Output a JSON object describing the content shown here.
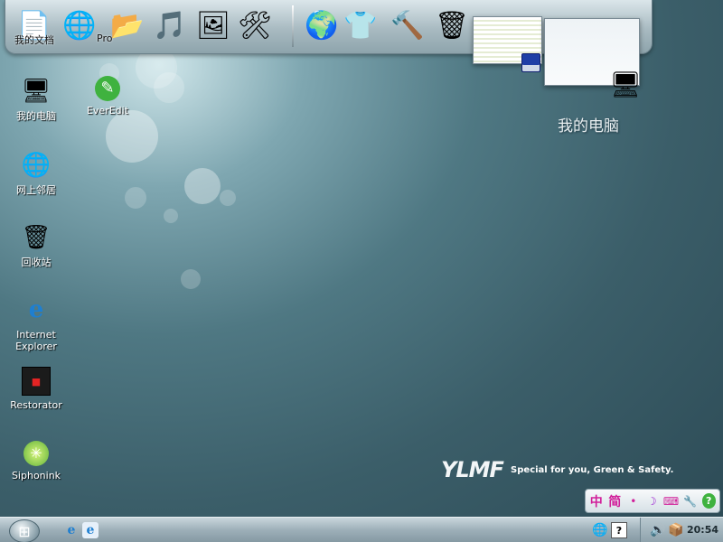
{
  "dock": {
    "items": [
      {
        "label": "我的文档",
        "icon": "documents-icon"
      },
      {
        "label": "Pro",
        "icon": "program-files-icon"
      },
      {
        "label": "",
        "icon": "folder-icon"
      },
      {
        "label": "",
        "icon": "music-folder-icon"
      },
      {
        "label": "",
        "icon": "picture-folder-icon"
      },
      {
        "label": "",
        "icon": "tools-icon"
      },
      {
        "label": "",
        "icon": "globe-icon"
      },
      {
        "label": "",
        "icon": "tshirt-icon"
      },
      {
        "label": "",
        "icon": "hammer-icon"
      },
      {
        "label": "",
        "icon": "recycle-bin-icon"
      }
    ]
  },
  "desktop": {
    "icons": [
      {
        "label": "我的电脑",
        "icon": "my-computer-icon"
      },
      {
        "label": "EverEdit",
        "icon": "everedit-icon"
      },
      {
        "label": "网上邻居",
        "icon": "network-icon"
      },
      {
        "label": "回收站",
        "icon": "recycle-bin-icon"
      },
      {
        "label": "Internet Explorer",
        "icon": "internet-explorer-icon"
      },
      {
        "label": "Restorator",
        "icon": "restorator-icon"
      },
      {
        "label": "Siphonink",
        "icon": "siphonink-icon"
      }
    ],
    "big_label": "我的电脑"
  },
  "branding": {
    "logo": "YLMF",
    "tagline": "Special for you, Green & Safety."
  },
  "ime": {
    "items": [
      "中",
      "简",
      "full-width-icon",
      "moon-icon",
      "keyboard-icon",
      "wrench-icon",
      "help-icon"
    ]
  },
  "taskbar": {
    "start": "windows-logo-icon",
    "quick_launch": [
      "internet-explorer-icon",
      "ie-shortcut-icon"
    ],
    "tray": [
      "network-tray-icon",
      "help-tray-icon",
      "volume-icon",
      "box-icon"
    ],
    "clock": "20:54"
  },
  "colors": {
    "desktop_bg": "#4f7883",
    "accent": "#2f8fd6"
  }
}
